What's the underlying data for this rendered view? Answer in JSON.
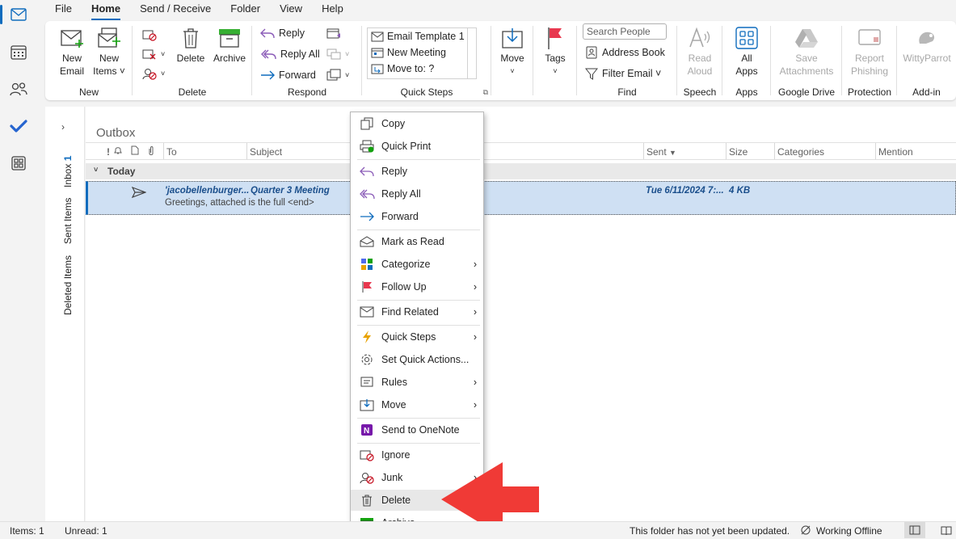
{
  "menu_tabs": [
    "File",
    "Home",
    "Send / Receive",
    "Folder",
    "View",
    "Help"
  ],
  "ribbon": {
    "new": {
      "group": "New",
      "new_email": [
        "New",
        "Email"
      ],
      "new_items": [
        "New",
        "Items ˅"
      ]
    },
    "delete": {
      "group": "Delete",
      "delete": "Delete",
      "archive": "Archive"
    },
    "respond": {
      "group": "Respond",
      "reply": "Reply",
      "reply_all": "Reply All",
      "forward": "Forward"
    },
    "quicksteps": {
      "group": "Quick Steps",
      "items": [
        "Email Template 1",
        "New Meeting",
        "Move to: ?"
      ]
    },
    "move": {
      "label": "Move"
    },
    "tags": {
      "label": "Tags"
    },
    "find": {
      "group": "Find",
      "search_placeholder": "Search People",
      "address_book": "Address Book",
      "filter_email": "Filter Email ˅"
    },
    "speech": {
      "group": "Speech",
      "read_aloud": [
        "Read",
        "Aloud"
      ]
    },
    "apps": {
      "group": "Apps",
      "all_apps": [
        "All",
        "Apps"
      ]
    },
    "gdrive": {
      "group": "Google Drive",
      "save_attachments": [
        "Save",
        "Attachments"
      ]
    },
    "protection": {
      "group": "Protection",
      "report_phishing": [
        "Report",
        "Phishing"
      ]
    },
    "addin": {
      "group": "Add-in",
      "wittyparrot": "WittyParrot"
    }
  },
  "folder_pane": {
    "inbox": "Inbox",
    "inbox_count": "1",
    "sent": "Sent Items",
    "deleted": "Deleted Items"
  },
  "list": {
    "folder_title": "Outbox",
    "columns": {
      "importance": "!",
      "to": "To",
      "subject": "Subject",
      "sent": "Sent",
      "size": "Size",
      "categories": "Categories",
      "mention": "Mention"
    },
    "group": "Today",
    "message": {
      "to": "'jacobellenburger...",
      "subject": "Quarter 3 Meeting",
      "preview": "Greetings, attached is the full <end>",
      "sent": "Tue 6/11/2024 7:...",
      "size": "4 KB"
    }
  },
  "context_menu": {
    "copy": "Copy",
    "quick_print": "Quick Print",
    "reply": "Reply",
    "reply_all": "Reply All",
    "forward": "Forward",
    "mark_as_read": "Mark as Read",
    "categorize": "Categorize",
    "follow_up": "Follow Up",
    "find_related": "Find Related",
    "quick_steps": "Quick Steps",
    "set_quick_actions": "Set Quick Actions...",
    "rules": "Rules",
    "move": "Move",
    "send_to_onenote": "Send to OneNote",
    "ignore": "Ignore",
    "junk": "Junk",
    "delete": "Delete",
    "archive": "Archive..."
  },
  "status": {
    "items": "Items: 1",
    "unread": "Unread: 1",
    "folder_status": "This folder has not yet been updated.",
    "connection": "Working Offline"
  },
  "colors": {
    "accent": "#0f6cbd",
    "selection": "#cfe0f3",
    "arrow": "#f03a36"
  }
}
